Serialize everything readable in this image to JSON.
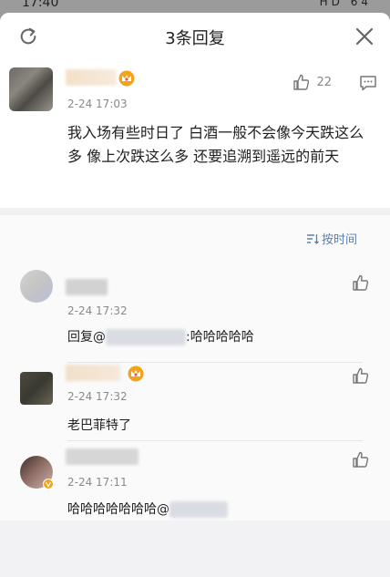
{
  "status_bar": {
    "time": "17:40",
    "signal_text": "HD 64"
  },
  "header": {
    "title": "3条回复"
  },
  "main_comment": {
    "time": "2-24 17:03",
    "likes": "22",
    "text": "我入场有些时日了 白酒一般不会像今天跌这么多 像上次跌这么多 还要追溯到遥远的前天"
  },
  "sort": {
    "label": "按时间"
  },
  "replies": [
    {
      "time": "2-24 17:32",
      "prefix": "回复@",
      "suffix": ":哈哈哈哈哈"
    },
    {
      "time": "2-24 17:32",
      "text": "老巴菲特了"
    },
    {
      "time": "2-24 17:11",
      "text": "哈哈哈哈哈哈哈@"
    }
  ],
  "colors": {
    "accent": "#5a7fae",
    "crown": "#f2a31b"
  }
}
